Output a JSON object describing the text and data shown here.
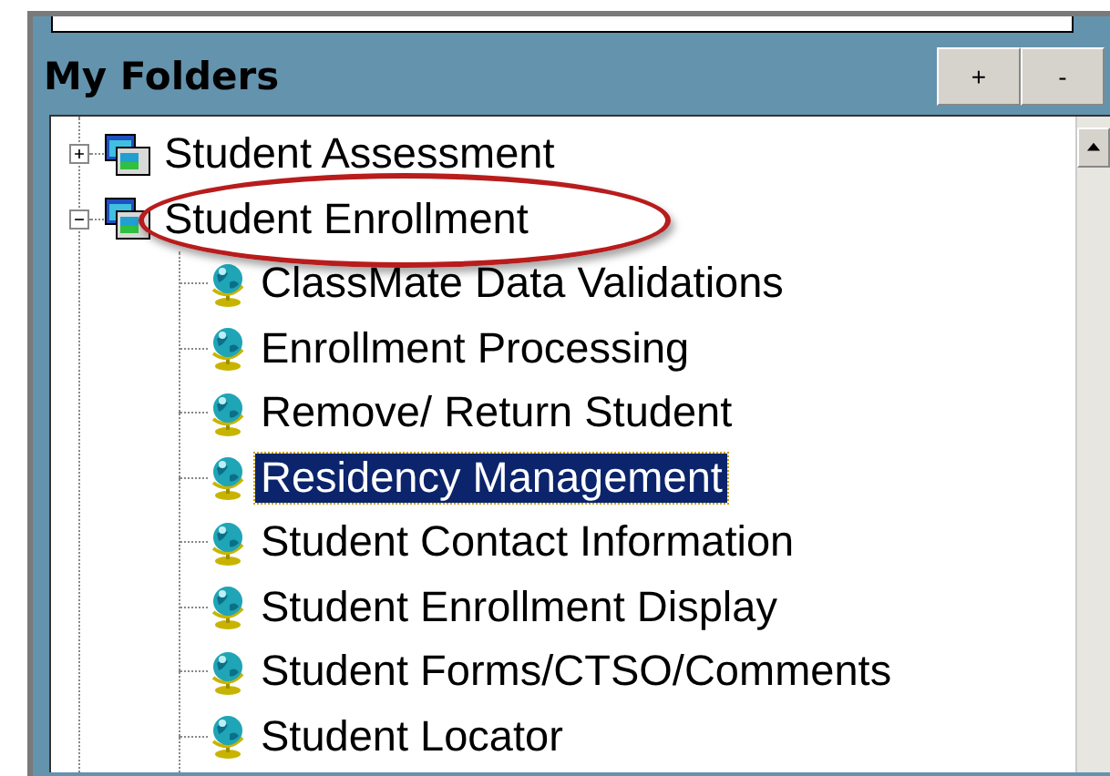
{
  "panel": {
    "title": "My Folders",
    "buttons": [
      "+",
      "-"
    ]
  },
  "tree": [
    {
      "label": "Student Assessment",
      "expanded": false,
      "selected": false
    },
    {
      "label": "Student Enrollment",
      "expanded": true,
      "selected": false,
      "highlighted": true,
      "children": [
        {
          "label": "ClassMate Data Validations",
          "selected": false
        },
        {
          "label": "Enrollment Processing",
          "selected": false
        },
        {
          "label": "Remove/ Return Student",
          "selected": false
        },
        {
          "label": "Residency Management",
          "selected": true
        },
        {
          "label": "Student Contact Information",
          "selected": false
        },
        {
          "label": "Student Enrollment Display",
          "selected": false
        },
        {
          "label": "Student Forms/CTSO/Comments",
          "selected": false
        },
        {
          "label": "Student Locator",
          "selected": false
        }
      ]
    }
  ]
}
